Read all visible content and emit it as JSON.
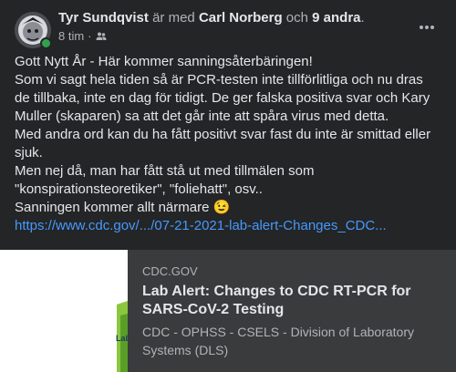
{
  "header": {
    "author": "Tyr Sundqvist",
    "with_text": "är med",
    "tagged": "Carl Norberg",
    "and_text": "och",
    "others": "9 andra",
    "period": "."
  },
  "meta": {
    "time": "8 tim",
    "separator": "·",
    "audience_icon": "friends-icon"
  },
  "post": {
    "lines": [
      "Gott Nytt År - Här kommer sanningsåterbäringen!",
      "Som vi sagt hela tiden så är PCR-testen inte tillförlitliga och nu dras de tillbaka, inte en dag för tidigt. De ger falska positiva svar och Kary Muller (skaparen) sa att det går inte att spåra virus med detta.",
      "Med andra ord kan du ha fått positivt svar fast du inte är smittad eller sjuk.",
      "Men nej då, man har fått stå ut med tillmälen som \"konspirationsteoretiker\", \"foliehatt\", osv..",
      "Sanningen kommer allt närmare 😉"
    ],
    "link": "https://www.cdc.gov/.../07-21-2021-lab-alert-Changes_CDC..."
  },
  "card": {
    "domain": "CDC.GOV",
    "title": "Lab Alert: Changes to CDC RT-PCR for SARS-CoV-2 Testing",
    "description": "CDC - OPHSS - CSELS - Division of Laboratory Systems (DLS)",
    "thumb_text": "Lab"
  },
  "colors": {
    "background": "#242526",
    "card_background": "#3a3b3c",
    "link": "#4599ff",
    "online": "#31a24c",
    "thumb_green": "#8cc63f"
  }
}
